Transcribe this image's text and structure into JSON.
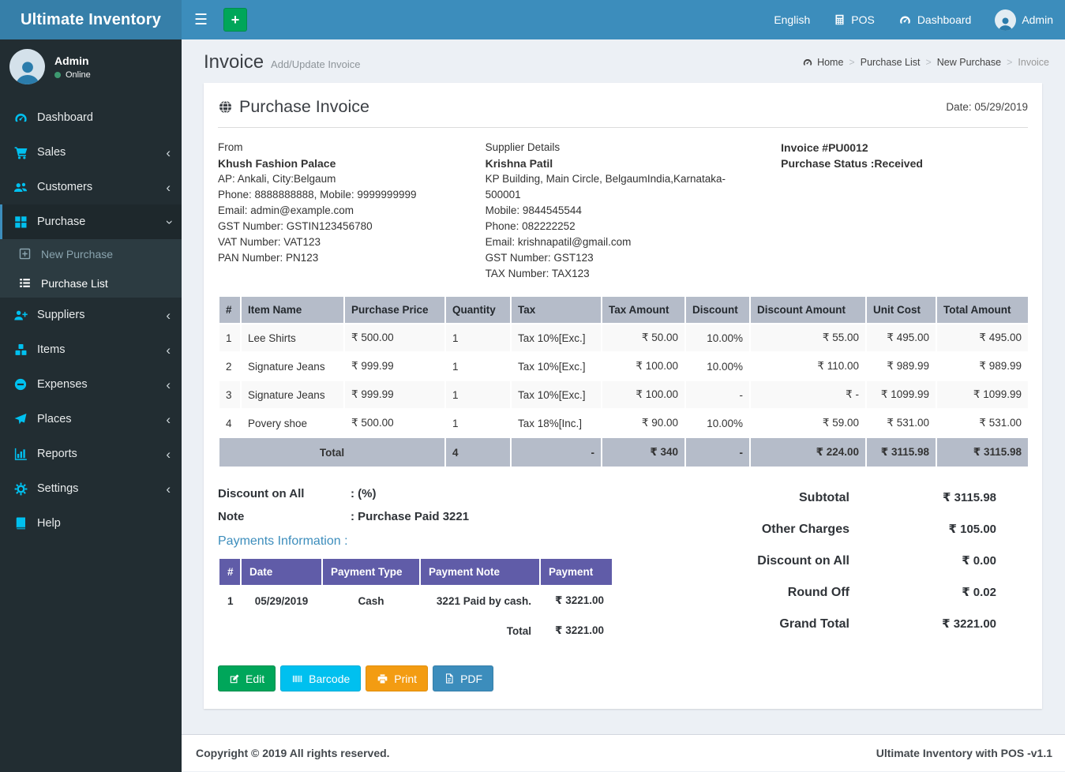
{
  "app": {
    "title": "Ultimate Inventory",
    "add_button": "+"
  },
  "navbar": {
    "items": [
      {
        "label": "English"
      },
      {
        "label": "POS",
        "icon": "pos-icon"
      },
      {
        "label": "Dashboard",
        "icon": "dashboard-icon"
      },
      {
        "label": "Admin",
        "icon": "avatar"
      }
    ]
  },
  "sidebar": {
    "user": {
      "name": "Admin",
      "status": "Online"
    },
    "items": [
      {
        "label": "Dashboard",
        "icon": "dashboard-icon"
      },
      {
        "label": "Sales",
        "icon": "cart-icon"
      },
      {
        "label": "Customers",
        "icon": "users-icon"
      },
      {
        "label": "Purchase",
        "icon": "grid-icon",
        "children": [
          {
            "label": "New Purchase",
            "icon": "plus-square-icon"
          },
          {
            "label": "Purchase List",
            "icon": "list-icon"
          }
        ]
      },
      {
        "label": "Suppliers",
        "icon": "user-plus-icon"
      },
      {
        "label": "Items",
        "icon": "cubes-icon"
      },
      {
        "label": "Expenses",
        "icon": "minus-circle-icon"
      },
      {
        "label": "Places",
        "icon": "paper-plane-icon"
      },
      {
        "label": "Reports",
        "icon": "bar-chart-icon"
      },
      {
        "label": "Settings",
        "icon": "gears-icon"
      },
      {
        "label": "Help",
        "icon": "book-icon"
      }
    ]
  },
  "page": {
    "title": "Invoice",
    "subtitle": "Add/Update Invoice",
    "breadcrumb": [
      "Home",
      "Purchase List",
      "New Purchase",
      "Invoice"
    ]
  },
  "invoice": {
    "heading": "Purchase Invoice",
    "date": "Date: 05/29/2019",
    "from": {
      "label": "From",
      "name": "Khush Fashion Palace",
      "address": "AP: Ankali, City:Belgaum",
      "phones": "Phone: 8888888888, Mobile: 9999999999",
      "email": "Email: admin@example.com",
      "gst": "GST Number: GSTIN123456780",
      "vat": "VAT Number: VAT123",
      "pan": "PAN Number: PN123"
    },
    "supplier": {
      "label": "Supplier Details",
      "name": "Krishna Patil",
      "address": "KP Building, Main Circle, BelgaumIndia,Karnataka-500001",
      "mobile": "Mobile: 9844545544",
      "phone": "Phone: 082222252",
      "email": "Email: krishnapatil@gmail.com",
      "gst": "GST Number: GST123",
      "tax": "TAX Number: TAX123"
    },
    "number": "Invoice #PU0012",
    "status": "Purchase Status :Received"
  },
  "items_table": {
    "columns": [
      "#",
      "Item Name",
      "Purchase Price",
      "Quantity",
      "Tax",
      "Tax Amount",
      "Discount",
      "Discount Amount",
      "Unit Cost",
      "Total Amount"
    ],
    "rows": [
      [
        "1",
        "Lee Shirts",
        "₹ 500.00",
        "1",
        "Tax 10%[Exc.]",
        "₹ 50.00",
        "10.00%",
        "₹ 55.00",
        "₹ 495.00",
        "₹ 495.00"
      ],
      [
        "2",
        "Signature Jeans",
        "₹ 999.99",
        "1",
        "Tax 10%[Exc.]",
        "₹ 100.00",
        "10.00%",
        "₹ 110.00",
        "₹ 989.99",
        "₹ 989.99"
      ],
      [
        "3",
        "Signature Jeans",
        "₹ 999.99",
        "1",
        "Tax 10%[Exc.]",
        "₹ 100.00",
        "-",
        "₹ -",
        "₹ 1099.99",
        "₹ 1099.99"
      ],
      [
        "4",
        "Povery shoe",
        "₹ 500.00",
        "1",
        "Tax 18%[Inc.]",
        "₹ 90.00",
        "10.00%",
        "₹ 59.00",
        "₹ 531.00",
        "₹ 531.00"
      ]
    ],
    "total_row": [
      "Total",
      "4",
      "-",
      "₹ 340",
      "-",
      "₹ 224.00",
      "₹ 3115.98",
      "₹ 3115.98"
    ]
  },
  "details": {
    "discount_label": "Discount on All",
    "discount_value": ": (%)",
    "note_label": "Note",
    "note_value": ": Purchase Paid 3221"
  },
  "payments": {
    "heading": "Payments Information :",
    "columns": [
      "#",
      "Date",
      "Payment Type",
      "Payment Note",
      "Payment"
    ],
    "rows": [
      [
        "1",
        "05/29/2019",
        "Cash",
        "3221 Paid by cash.",
        "₹ 3221.00"
      ]
    ],
    "total_label": "Total",
    "total_value": "₹ 3221.00"
  },
  "summary": {
    "rows": [
      {
        "label": "Subtotal",
        "value": "₹ 3115.98"
      },
      {
        "label": "Other Charges",
        "value": "₹ 105.00"
      },
      {
        "label": "Discount on All",
        "value": "₹ 0.00"
      },
      {
        "label": "Round Off",
        "value": "₹ 0.02"
      },
      {
        "label": "Grand Total",
        "value": "₹ 3221.00"
      }
    ]
  },
  "actions": [
    {
      "label": "Edit",
      "icon": "edit-icon",
      "color": "#00a65a"
    },
    {
      "label": "Barcode",
      "icon": "barcode-icon",
      "color": "#00c0ef"
    },
    {
      "label": "Print",
      "icon": "print-icon",
      "color": "#f39c12"
    },
    {
      "label": "PDF",
      "icon": "pdf-icon",
      "color": "#3c8dbc"
    }
  ],
  "footer": {
    "left": "Copyright © 2019 All rights reserved.",
    "right": "Ultimate Inventory with POS -v1.1"
  },
  "colors": {
    "navbar": "#3c8dbc",
    "logo_bg": "#367fa9",
    "sidebar_bg": "#222d32",
    "submenu_bg": "#2c3b41",
    "active_item_bg": "#1e282c",
    "sidebar_icon": "#00c0ef",
    "content_bg": "#ecf0f5",
    "table_header_bg": "#b5bcc9",
    "payments_header_bg": "#605ca8",
    "btn_edit": "#00a65a",
    "btn_barcode": "#00c0ef",
    "btn_print": "#f39c12",
    "btn_pdf": "#3c8dbc",
    "online_dot": "#3d9970",
    "link_blue": "#3c8dbc"
  }
}
